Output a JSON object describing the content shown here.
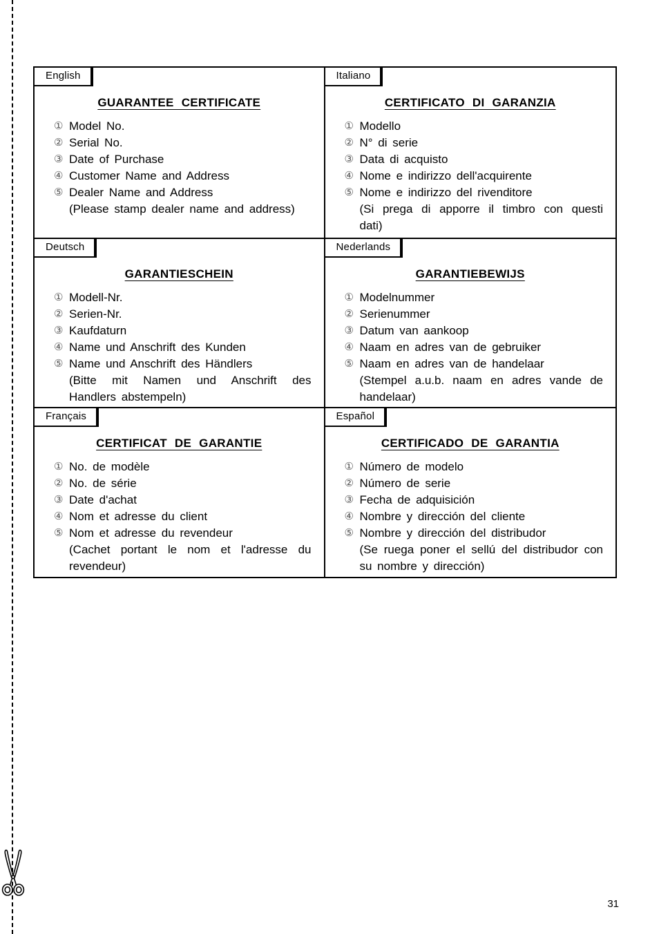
{
  "page": {
    "number": "31",
    "cut_line_icon": "scissors-icon"
  },
  "table": {
    "cells": [
      {
        "language": "English",
        "title": "GUARANTEE  CERTIFICATE",
        "items": [
          {
            "marker": "①",
            "text": "Model  No."
          },
          {
            "marker": "②",
            "text": "Serial  No."
          },
          {
            "marker": "③",
            "text": "Date  of  Purchase"
          },
          {
            "marker": "④",
            "text": "Customer  Name  and  Address"
          },
          {
            "marker": "⑤",
            "text": "Dealer  Name  and  Address"
          }
        ],
        "note": "(Please  stamp  dealer  name  and  address)"
      },
      {
        "language": "Italiano",
        "title": "CERTIFICATO  DI  GARANZIA",
        "items": [
          {
            "marker": "①",
            "text": "Modello"
          },
          {
            "marker": "②",
            "text": "N°  di  serie"
          },
          {
            "marker": "③",
            "text": "Data  di  acquisto"
          },
          {
            "marker": "④",
            "text": "Nome  e  indirizzo  dell'acquirente"
          },
          {
            "marker": "⑤",
            "text": "Nome  e  indirizzo  del  rivenditore"
          }
        ],
        "note": "(Si  prega  di  apporre  il  timbro  con  questi  dati)"
      },
      {
        "language": "Deutsch",
        "title": "GARANTIESCHEIN",
        "items": [
          {
            "marker": "①",
            "text": "Modell-Nr."
          },
          {
            "marker": "②",
            "text": "Serien-Nr."
          },
          {
            "marker": "③",
            "text": "Kaufdaturn"
          },
          {
            "marker": "④",
            "text": "Name  und  Anschrift  des  Kunden"
          },
          {
            "marker": "⑤",
            "text": "Name  und  Anschrift  des  Händlers"
          }
        ],
        "note": "(Bitte  mit  Namen  und  Anschrift  des  Handlers  abstempeln)"
      },
      {
        "language": "Nederlands",
        "title": "GARANTIEBEWIJS",
        "items": [
          {
            "marker": "①",
            "text": "Modelnummer"
          },
          {
            "marker": "②",
            "text": "Serienummer"
          },
          {
            "marker": "③",
            "text": "Datum  van  aankoop"
          },
          {
            "marker": "④",
            "text": "Naam  en  adres  van  de  gebruiker"
          },
          {
            "marker": "⑤",
            "text": "Naam  en  adres  van  de  handelaar"
          }
        ],
        "note": "(Stempel  a.u.b.  naam  en  adres  vande  de  handelaar)"
      },
      {
        "language": "Français",
        "title": "CERTIFICAT  DE  GARANTIE",
        "items": [
          {
            "marker": "①",
            "text": "No.  de  modèle"
          },
          {
            "marker": "②",
            "text": "No.  de  série"
          },
          {
            "marker": "③",
            "text": "Date  d'achat"
          },
          {
            "marker": "④",
            "text": "Nom  et  adresse  du  client"
          },
          {
            "marker": "⑤",
            "text": "Nom  et  adresse  du  revendeur"
          }
        ],
        "note": "(Cachet  portant  le  nom  et  l'adresse  du  revendeur)"
      },
      {
        "language": "Español",
        "title": "CERTIFICADO  DE  GARANTIA",
        "items": [
          {
            "marker": "①",
            "text": "Número  de  modelo"
          },
          {
            "marker": "②",
            "text": "Número  de  serie"
          },
          {
            "marker": "③",
            "text": "Fecha  de  adquisición"
          },
          {
            "marker": "④",
            "text": "Nombre  y  dirección  del  cliente"
          },
          {
            "marker": "⑤",
            "text": "Nombre  y  dirección  del  distribudor"
          }
        ],
        "note": "(Se  ruega  poner  el  sellú  del  distribudor  con  su  nombre  y  dirección)"
      }
    ]
  }
}
